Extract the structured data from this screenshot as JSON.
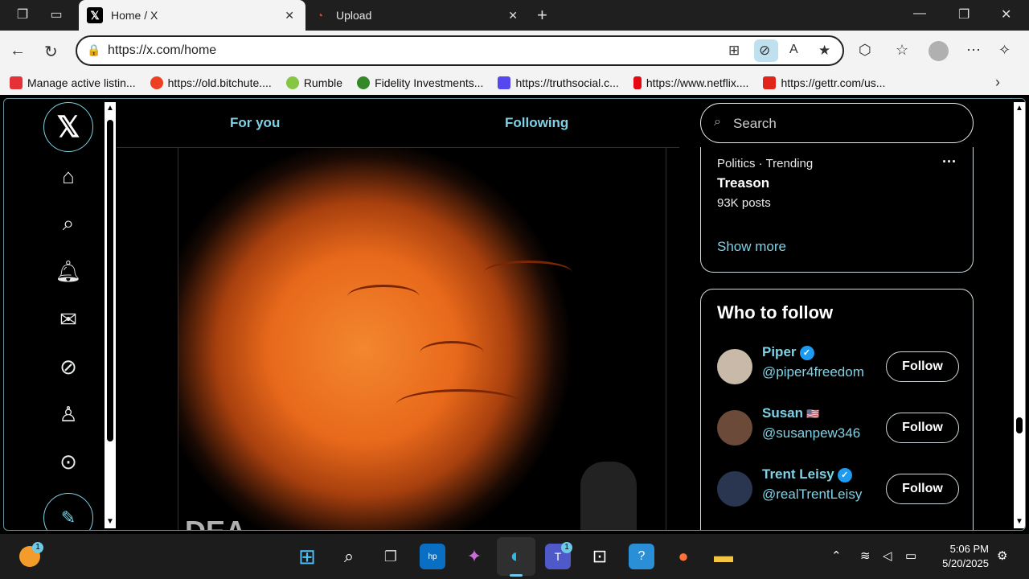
{
  "browser": {
    "tabs": [
      {
        "title": "Home / X",
        "favicon": "x-logo-icon",
        "active": true
      },
      {
        "title": "Upload",
        "favicon": "bitchute-icon",
        "active": false
      }
    ],
    "url": "https://x.com/home",
    "bookmarks": [
      {
        "label": "Manage active listin...",
        "color": "#e53238"
      },
      {
        "label": "https://old.bitchute....",
        "color": "#ef3f23"
      },
      {
        "label": "Rumble",
        "color": "#85c742"
      },
      {
        "label": "Fidelity Investments...",
        "color": "#368727"
      },
      {
        "label": "https://truthsocial.c...",
        "color": "#5448ee"
      },
      {
        "label": "https://www.netflix....",
        "color": "#e50914"
      },
      {
        "label": "https://gettr.com/us...",
        "color": "#e1251b"
      }
    ]
  },
  "x": {
    "feed_tabs": [
      "For you",
      "Following"
    ],
    "nav_icons": [
      "home-icon",
      "search-icon",
      "bell-icon",
      "mail-icon",
      "grok-icon",
      "profile-icon",
      "more-icon"
    ],
    "search_placeholder": "Search",
    "trend": {
      "meta": "Politics · Trending",
      "title": "Treason",
      "count": "93K posts",
      "show_more": "Show more"
    },
    "who_to_follow": {
      "title": "Who to follow",
      "users": [
        {
          "name": "Piper",
          "handle": "@piper4freedom",
          "verified": true,
          "flag": false,
          "button": "Follow",
          "avatar_color": "#c9b9a8"
        },
        {
          "name": "Susan",
          "handle": "@susanpew346",
          "verified": false,
          "flag": true,
          "button": "Follow",
          "avatar_color": "#6b4a3a"
        },
        {
          "name": "Trent Leisy",
          "handle": "@realTrentLeisy",
          "verified": true,
          "flag": false,
          "button": "Follow",
          "avatar_color": "#2a3550"
        }
      ]
    },
    "media_watermark": "DEA"
  },
  "taskbar": {
    "time": "5:06 PM",
    "date": "5/20/2025",
    "weather_badge": "1",
    "teams_badge": "1"
  },
  "colors": {
    "accent": "#7fd2e6",
    "verified": "#1d9bf0"
  }
}
